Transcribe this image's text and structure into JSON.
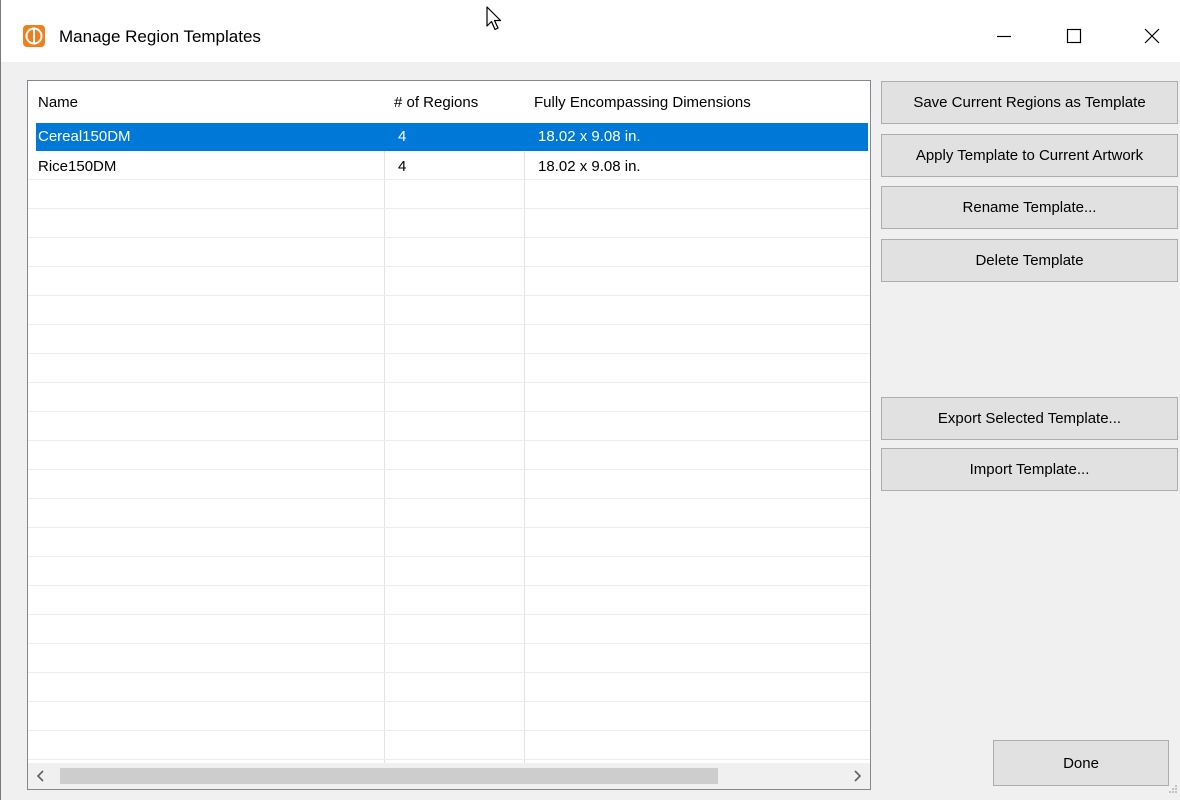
{
  "window": {
    "title": "Manage Region Templates",
    "icons": {
      "app": "app-logo-icon",
      "minimize": "minimize-icon",
      "maximize": "maximize-icon",
      "close": "close-icon"
    }
  },
  "colors": {
    "selection": "#0078d7",
    "button_face": "#e1e1e1",
    "dialog_bg": "#f0f0f0"
  },
  "list": {
    "columns": [
      "Name",
      "# of Regions",
      "Fully Encompassing Dimensions"
    ],
    "rows": [
      {
        "name": "Cereal150DM",
        "regions": "4",
        "dimensions": "18.02 x 9.08 in.",
        "selected": true
      },
      {
        "name": "Rice150DM",
        "regions": "4",
        "dimensions": "18.02 x 9.08 in.",
        "selected": false
      }
    ],
    "scroll_left_icon": "chevron-left-icon",
    "scroll_right_icon": "chevron-right-icon"
  },
  "buttons": {
    "save": "Save Current Regions as Template",
    "apply": "Apply Template to Current Artwork",
    "rename": "Rename Template...",
    "delete": "Delete Template",
    "export": "Export Selected Template...",
    "import": "Import Template...",
    "done": "Done"
  }
}
